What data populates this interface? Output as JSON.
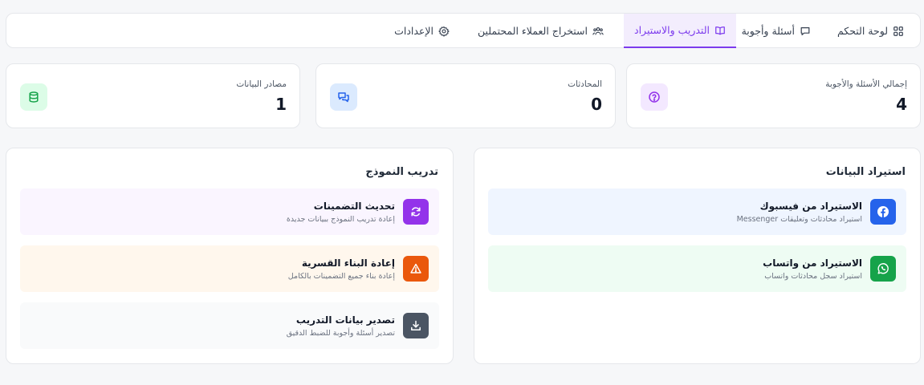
{
  "nav": {
    "tabs": [
      {
        "label": "لوحة التحكم",
        "icon": "grid-icon"
      },
      {
        "label": "أسئلة وأجوبة",
        "icon": "chat-icon"
      },
      {
        "label": "التدريب والاستيراد",
        "icon": "book-icon",
        "active": true
      },
      {
        "label": "استخراج العملاء المحتملين",
        "icon": "users-icon"
      },
      {
        "label": "الإعدادات",
        "icon": "gear-icon"
      }
    ]
  },
  "stats": [
    {
      "label": "إجمالي الأسئلة والأجوبة",
      "value": "4",
      "icon": "question-icon",
      "color": "#9333ea",
      "bg": "#f3e8ff"
    },
    {
      "label": "المحادثات",
      "value": "0",
      "icon": "messages-icon",
      "color": "#2563eb",
      "bg": "#dbeafe"
    },
    {
      "label": "مصادر البيانات",
      "value": "1",
      "icon": "database-icon",
      "color": "#16a34a",
      "bg": "#dcfce7"
    }
  ],
  "import": {
    "title": "استيراد البيانات",
    "items": [
      {
        "title": "الاستيراد من فيسبوك",
        "desc": "استيراد محادثات وتعليقات Messenger",
        "icon": "facebook-icon",
        "color": "#2563eb",
        "bg": "#eff5ff"
      },
      {
        "title": "الاستيراد من واتساب",
        "desc": "استيراد سجل محادثات واتساب",
        "icon": "whatsapp-icon",
        "color": "#16a34a",
        "bg": "#eefcf3"
      }
    ]
  },
  "training": {
    "title": "تدريب النموذج",
    "items": [
      {
        "title": "تحديث التضمينات",
        "desc": "إعادة تدريب النموذج ببيانات جديدة",
        "icon": "refresh-icon",
        "color": "#9333ea",
        "bg": "#faf5ff"
      },
      {
        "title": "إعادة البناء القسرية",
        "desc": "إعادة بناء جميع التضمينات بالكامل",
        "icon": "warning-icon",
        "color": "#ea580c",
        "bg": "#fff7ed"
      },
      {
        "title": "تصدير بيانات التدريب",
        "desc": "تصدير أسئلة وأجوبة للضبط الدقيق",
        "icon": "download-icon",
        "color": "#4b5563",
        "bg": "#f9fafb"
      }
    ]
  }
}
